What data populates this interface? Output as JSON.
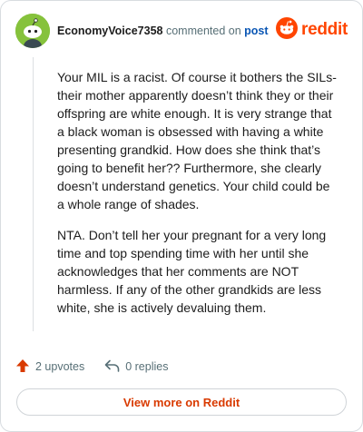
{
  "comment": {
    "username": "EconomyVoice7358",
    "commented_on_text": "commented on",
    "post_link": "post",
    "brand": "reddit",
    "paragraphs": [
      "Your MIL is a racist. Of course it bothers the SILs- their mother apparently doesn’t think they or their offspring are white enough. It is very strange that a black woman is obsessed with having a white presenting grandkid. How does she think that’s going to benefit her?? Furthermore, she clearly doesn’t understand genetics. Your child could be a whole range of shades.",
      "NTA. Don’t tell her your pregnant for a very long time and top spending time with her until she acknowledges that her comments are NOT harmless. If any of the other grandkids are less white, she is actively devaluing them."
    ],
    "upvotes_label": "2 upvotes",
    "replies_label": "0 replies",
    "view_more_label": "View more on Reddit"
  },
  "colors": {
    "brand": "#ff4500",
    "avatar_bg": "#86c23c",
    "link": "#0a56b4",
    "upvote": "#d93a00"
  },
  "icons": {
    "avatar": "snoo-avatar-icon",
    "brand": "reddit-logo-icon",
    "upvote": "upvote-arrow-icon",
    "reply": "reply-arrow-icon"
  }
}
